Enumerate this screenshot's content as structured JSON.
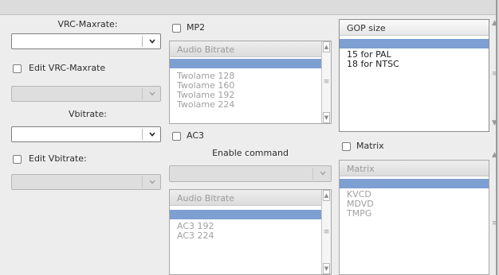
{
  "col1": {
    "vrc_maxrate_label": "VRC-Maxrate:",
    "edit_vrc_maxrate_label": "Edit VRC-Maxrate",
    "vbitrate_label": "Vbitrate:",
    "edit_vbitrate_label": "Edit Vbitrate:"
  },
  "col2": {
    "mp2_label": "MP2",
    "mp2_list": {
      "header": "Audio Bitrate",
      "items": [
        "Twolame 128",
        "Twolame 160",
        "Twolame 192",
        "Twolame 224"
      ]
    },
    "ac3_label": "AC3",
    "enable_command_label": "Enable command",
    "ac3_list": {
      "header": "Audio Bitrate",
      "items": [
        "AC3 192",
        "AC3 224"
      ]
    }
  },
  "col3": {
    "gop_list": {
      "header": "GOP size",
      "items": [
        "15 for PAL",
        "18 for NTSC"
      ]
    },
    "matrix_label": "Matrix",
    "matrix_list": {
      "header": "Matrix",
      "items": [
        "KVCD",
        "MDVD",
        "TMPG"
      ]
    }
  },
  "icons": {
    "dropdown": "chevron-down-icon",
    "scroll_up": "scroll-up-icon",
    "scroll_down": "scroll-down-icon",
    "scroll_grip": "scroll-grip-icon"
  },
  "colors": {
    "selection": "#7e9fd1",
    "window_bg": "#ededed",
    "disabled_field": "#dedede"
  }
}
